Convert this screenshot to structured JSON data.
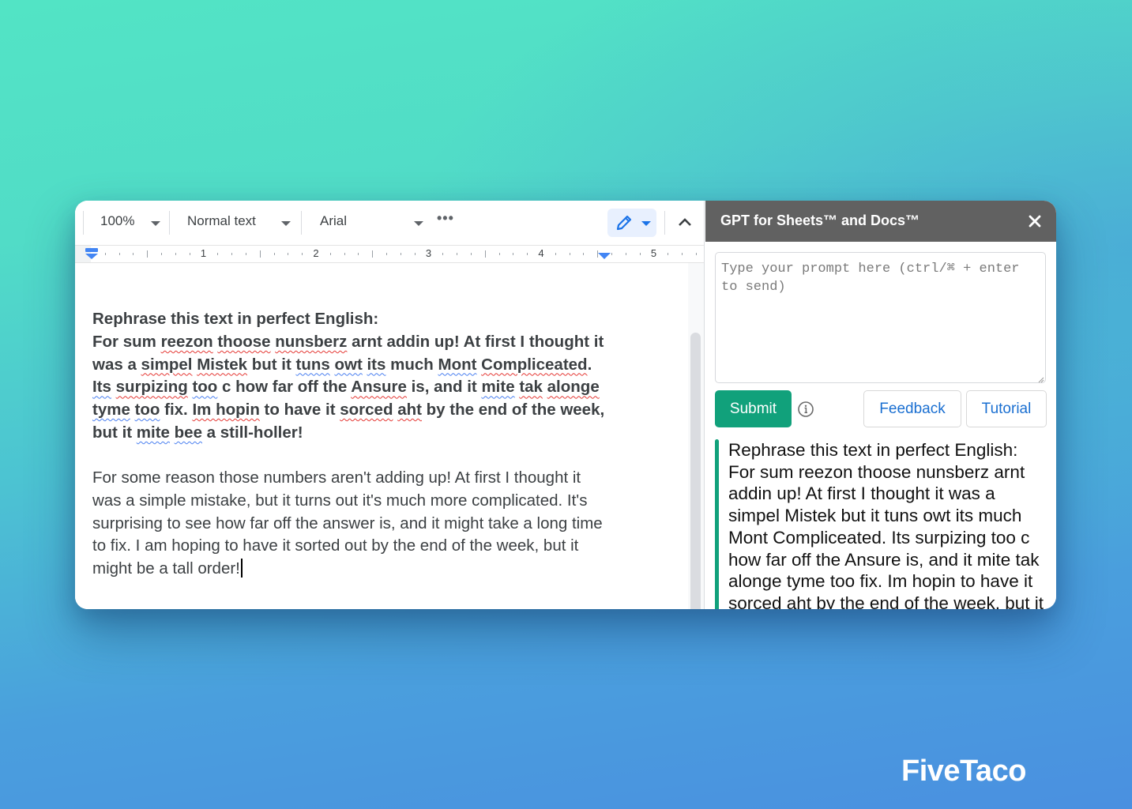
{
  "docs": {
    "toolbar": {
      "zoom": "100%",
      "style": "Normal text",
      "font": "Arial",
      "more_icon": "more-horizontal-icon",
      "edit_mode_icon": "pencil-icon",
      "collapse_icon": "chevron-up-icon"
    },
    "ruler": {
      "numbers": [
        "1",
        "2",
        "3",
        "4",
        "5"
      ]
    },
    "prompt_paragraph": {
      "heading": "Rephrase this text in perfect English:",
      "segments": [
        {
          "t": "For sum "
        },
        {
          "t": "reezon",
          "s": "red"
        },
        {
          "t": " "
        },
        {
          "t": "thoose",
          "s": "red"
        },
        {
          "t": " "
        },
        {
          "t": "nunsberz",
          "s": "red"
        },
        {
          "t": " arnt addin up! At first I thought it was a "
        },
        {
          "t": "simpel",
          "s": "red"
        },
        {
          "t": " "
        },
        {
          "t": "Mistek",
          "s": "red"
        },
        {
          "t": " but it "
        },
        {
          "t": "tuns",
          "s": "blue"
        },
        {
          "t": " "
        },
        {
          "t": "owt",
          "s": "blue"
        },
        {
          "t": " "
        },
        {
          "t": "its",
          "s": "blue"
        },
        {
          "t": " much "
        },
        {
          "t": "Mont",
          "s": "blue"
        },
        {
          "t": " "
        },
        {
          "t": "Compliceated",
          "s": "red"
        },
        {
          "t": ". "
        },
        {
          "t": "Its",
          "s": "blue"
        },
        {
          "t": " "
        },
        {
          "t": "surpizing",
          "s": "red"
        },
        {
          "t": " "
        },
        {
          "t": "too",
          "s": "blue"
        },
        {
          "t": " c how far off the "
        },
        {
          "t": "Ansure",
          "s": "red"
        },
        {
          "t": " is, and it "
        },
        {
          "t": "mite",
          "s": "blue"
        },
        {
          "t": " "
        },
        {
          "t": "tak",
          "s": "red"
        },
        {
          "t": " "
        },
        {
          "t": "alonge",
          "s": "red"
        },
        {
          "t": " "
        },
        {
          "t": "tyme",
          "s": "blue"
        },
        {
          "t": " "
        },
        {
          "t": "too",
          "s": "blue"
        },
        {
          "t": " fix. "
        },
        {
          "t": "Im hopin",
          "s": "red"
        },
        {
          "t": " to have it "
        },
        {
          "t": "sorced",
          "s": "red"
        },
        {
          "t": " "
        },
        {
          "t": "aht",
          "s": "red"
        },
        {
          "t": " by the end of the week, but it "
        },
        {
          "t": "mite",
          "s": "blue"
        },
        {
          "t": " "
        },
        {
          "t": "bee",
          "s": "blue"
        },
        {
          "t": " a still-holler!"
        }
      ]
    },
    "result_paragraph": "For some reason those numbers aren't adding up! At first I thought it was a simple mistake, but it turns out it's much more complicated. It's surprising to see how far off the answer is, and it might take a long time to fix. I am hoping to have it sorted out by the end of the week, but it might be a tall order!"
  },
  "sidebar": {
    "title": "GPT for Sheets™ and Docs™",
    "close_icon": "close-icon",
    "prompt_placeholder": "Type your prompt here (ctrl/⌘ + enter to send)",
    "prompt_value": "",
    "submit_label": "Submit",
    "info_icon": "info-icon",
    "feedback_label": "Feedback",
    "tutorial_label": "Tutorial",
    "history_text": "Rephrase this text in perfect English: For sum reezon thoose nunsberz arnt addin up! At first I thought it was a simpel Mistek but it tuns owt its much Mont Compliceated. Its surpizing too c how far off the Ansure is, and it mite tak alonge tyme too fix. Im hopin to have it sorced aht by the end of the week, but it mite bee a still-holler!"
  },
  "colors": {
    "accent_green": "#11a17b",
    "link_blue": "#1a6fd1",
    "header_gray": "#616161",
    "spell_error_red": "#e53935",
    "grammar_blue": "#4a80f0"
  },
  "branding": {
    "logo_text": "FiveTaco"
  }
}
